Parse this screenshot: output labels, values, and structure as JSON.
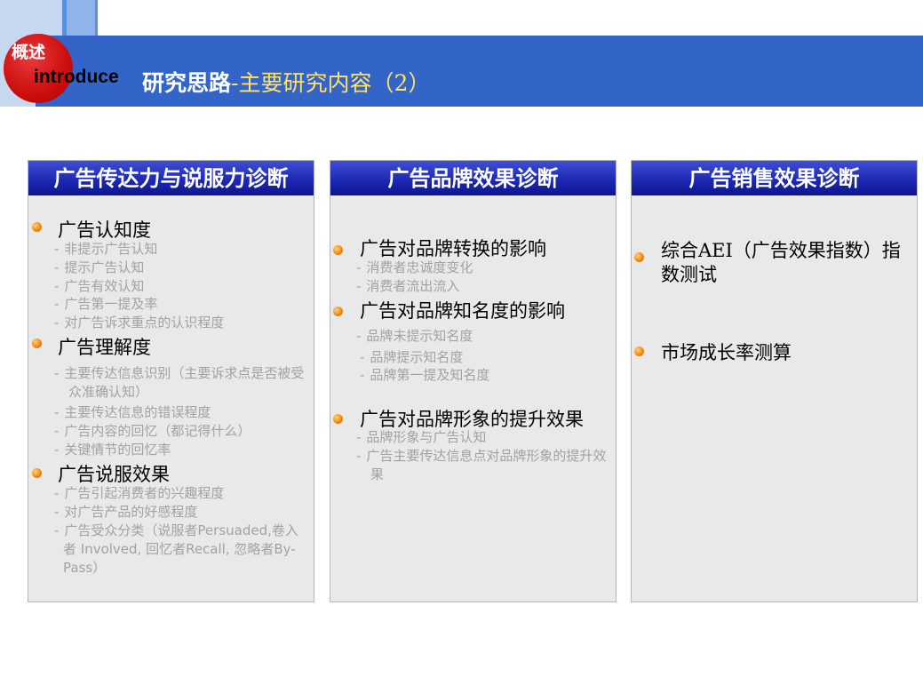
{
  "header": {
    "badge_label": "概述",
    "badge_sublabel": "introduce",
    "title_main": "研究思路",
    "title_sub": "-主要研究内容（2）"
  },
  "columns": [
    {
      "heading": "广告传达力与说服力诊断",
      "groups": [
        {
          "title": "广告认知度",
          "items": [
            "非提示广告认知",
            "提示广告认知",
            "广告有效认知",
            "广告第一提及率",
            "对广告诉求重点的认识程度"
          ]
        },
        {
          "title": "广告理解度",
          "items": [
            "主要传达信息识别（主要诉求点是否被受众准确认知）",
            "主要传达信息的错误程度",
            "广告内容的回忆（都记得什么）",
            "关键情节的回忆率"
          ]
        },
        {
          "title": "广告说服效果",
          "items": [
            "广告引起消费者的兴趣程度",
            "对广告产品的好感程度",
            "广告受众分类（说服者Persuaded,卷入者 Involved, 回忆者Recall, 忽略者By-Pass）"
          ]
        }
      ]
    },
    {
      "heading": "广告品牌效果诊断",
      "groups": [
        {
          "title": "广告对品牌转换的影响",
          "items": [
            "消费者忠诚度变化",
            "消费者流出流入"
          ]
        },
        {
          "title": "广告对品牌知名度的影响",
          "items": [
            "品牌未提示知名度",
            "品牌提示知名度",
            "品牌第一提及知名度"
          ]
        },
        {
          "title": "广告对品牌形象的提升效果",
          "items": [
            "品牌形象与广告认知",
            "广告主要传达信息点对品牌形象的提升效果"
          ]
        }
      ]
    },
    {
      "heading": "广告销售效果诊断",
      "groups": [
        {
          "title": "综合AEI（广告效果指数）指数测试",
          "items": []
        },
        {
          "title": "市场成长率测算",
          "items": []
        }
      ]
    }
  ]
}
